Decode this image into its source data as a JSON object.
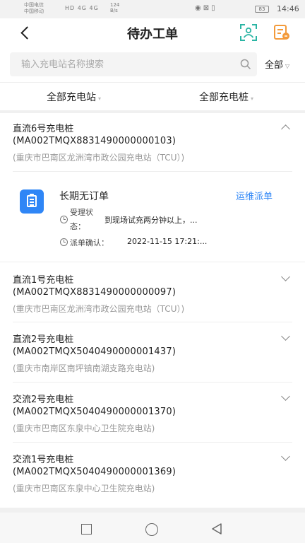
{
  "status_bar": {
    "carrier_1": "中国电信",
    "carrier_2": "中国移动",
    "network": "HD 4G 4G",
    "speed_value": "124",
    "speed_unit": "B/s",
    "icons": [
      "eye-icon",
      "alarm-icon",
      "vibrate-icon"
    ],
    "battery": "83",
    "time": "14:46"
  },
  "header": {
    "title": "待办工单",
    "back_icon": "chevron-left-icon",
    "scan_icon": "scan-icon",
    "doc_icon": "document-icon",
    "scan_color": "#2bb5a4",
    "doc_color": "#f39a3a"
  },
  "search": {
    "placeholder": "输入充电站名称搜索",
    "filter_label": "全部"
  },
  "tabs": [
    {
      "label": "全部充电站"
    },
    {
      "label": "全部充电桩"
    }
  ],
  "items": [
    {
      "name": "直流6号充电桩",
      "code": "(MA002TMQX8831490000000103)",
      "address": "(重庆市巴南区龙洲湾市政公园充电站（TCU）)",
      "expanded": true
    },
    {
      "name": "直流1号充电桩",
      "code": "(MA002TMQX8831490000000097)",
      "address": "(重庆市巴南区龙洲湾市政公园充电站（TCU）)",
      "expanded": false
    },
    {
      "name": "直流2号充电桩",
      "code": "(MA002TMQX5040490000001437)",
      "address": "(重庆市南岸区南坪镇南湖支路充电站)",
      "expanded": false
    },
    {
      "name": "交流2号充电桩",
      "code": "(MA002TMQX5040490000001370)",
      "address": "(重庆市巴南区东泉中心卫生院充电站)",
      "expanded": false
    },
    {
      "name": "交流1号充电桩",
      "code": "(MA002TMQX5040490000001369)",
      "address": "(重庆市巴南区东泉中心卫生院充电站)",
      "expanded": false
    }
  ],
  "order": {
    "title": "长期无订单",
    "action": "运维派单",
    "status_label_1": "受理状",
    "status_label_2": "态：",
    "status_value": "到现场试充两分钟以上，...",
    "confirm_label": "派单确认：",
    "confirm_value": "2022-11-15 17:21:...",
    "accent_color": "#2f86f6"
  },
  "nav": {
    "recent_icon": "square-icon",
    "home_icon": "circle-icon",
    "back_icon": "triangle-back-icon"
  }
}
